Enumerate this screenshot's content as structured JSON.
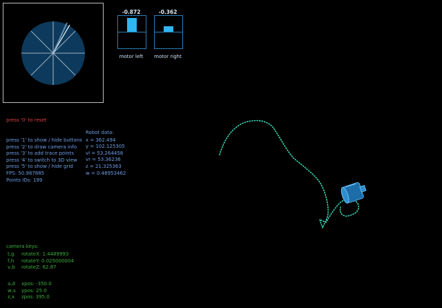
{
  "compass": {
    "name": "radar-view"
  },
  "meters": [
    {
      "id": "left",
      "value_text": "-0.872",
      "label": "motor left",
      "level": 0.872
    },
    {
      "id": "right",
      "value_text": "-0.362",
      "label": "motor right",
      "level": 0.362
    }
  ],
  "reset_hint": "press '0' to reset",
  "help_lines": [
    "press '1' to show / hide buttons",
    "press '2' to draw camera info",
    "press '3' to add trace points",
    "press '4' to switch to 3D view",
    "press '5' to show / hide grid",
    "FPS: 50.987885",
    "Points IDs: 199"
  ],
  "robot_data": {
    "title": "Robot data:",
    "lines": [
      "x = 362.494",
      "y = 102.125305",
      "vl = 53.264458",
      "vr = 53.36236",
      "z = 21.325363",
      "w = 0.48953462"
    ]
  },
  "camera_keys": {
    "title": "camera keys:",
    "rotate": [
      {
        "keys": "t,g",
        "text": "rotateX: 1.4489993"
      },
      {
        "keys": "f,h",
        "text": "rotateY: 0.025000004"
      },
      {
        "keys": "v,b",
        "text": "rotateZ: 62.87"
      }
    ],
    "position": [
      {
        "keys": "a,d",
        "text": "xpos: -350.0"
      },
      {
        "keys": "w,s",
        "text": "ypos: 25.0"
      },
      {
        "keys": "z,x",
        "text": "zpos: 395.0"
      }
    ]
  },
  "colors": {
    "background": "#000000",
    "panel_border": "#cccccc",
    "radar_fill": "#0d3a5c",
    "meter_fill": "#2fb6f0",
    "trace": "#38d6b4",
    "robot": "#2e8ccf",
    "help_text": "#6f9ee8",
    "reset_text": "#e04040",
    "camera_text": "#3fae3f"
  }
}
